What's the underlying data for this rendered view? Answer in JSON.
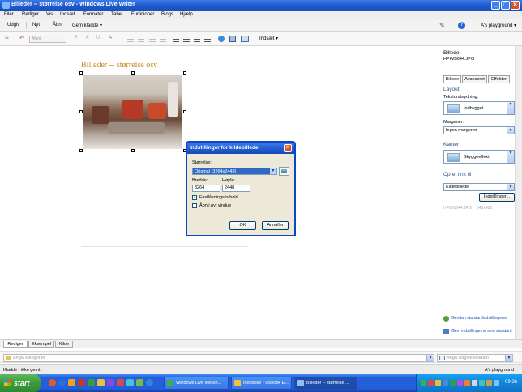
{
  "window": {
    "title": "Billeder  --  størrelse osv - Windows Live Writer",
    "min_glyph": "_",
    "max_glyph": "□",
    "close_glyph": "✕"
  },
  "menu": [
    "Filer",
    "Rediger",
    "Vis",
    "Indsæt",
    "Formater",
    "Tabel",
    "Funktioner",
    "Blogs",
    "Hjælp"
  ],
  "toolbar": {
    "publish": "Udgiv",
    "new": "Nyt",
    "open": "Åbn",
    "save_draft": "Gem kladde ▾",
    "help": "?",
    "account": "A's playground ▾"
  },
  "format_bar": {
    "font_placeholder": "Afsnit",
    "bold": "F",
    "italic": "K",
    "underline": "U",
    "strike": "A",
    "insert": "Indsæt ▾"
  },
  "post": {
    "title": "Billeder  --  størrelse osv"
  },
  "dialog": {
    "title": "Indstillinger for kildebillede",
    "size_label": "Størrelse:",
    "size_value": "Original (3264x2448)",
    "width_label": "Bredde:",
    "height_label": "Højde:",
    "width_value": "3264",
    "height_value": "2448",
    "keep_ratio_label": "Fastlåsningsforhold",
    "keep_ratio_checked": true,
    "new_window_label": "Åbn i nyt vindue",
    "new_window_checked": false,
    "ok": "OK",
    "cancel": "Annuller",
    "close_glyph": "✕"
  },
  "right_pane": {
    "heading": "Billede",
    "filename": "HPIM5644.JPG",
    "tabs": [
      "Billede",
      "Avanceret",
      "Effekter"
    ],
    "layout_section": "Layout",
    "wrap_label": "Tekstombrydning:",
    "wrap_value": "Indbygget",
    "margins_label": "Margener:",
    "margins_value": "Ingen margener",
    "borders_section": "Kanter",
    "border_value": "Skyggeeffekt",
    "link_section": "Opret link til",
    "link_value": "Kildebillede",
    "settings_button": "Indstillinger...",
    "meta_name": "HPIM5644.JPG",
    "meta_size": "640x480",
    "restore_link": "Gendan standardindstillingerne",
    "save_default_link": "Gem indstillingerne som standard"
  },
  "editor_tabs": [
    "Rediger",
    "Eksempel",
    "Kilde"
  ],
  "categories_placeholder": "Angiv kategorier",
  "publish_date_placeholder": "Angiv udgivelsesdato",
  "status": {
    "left": "Kladde - ikke gemt",
    "right": "A's playground"
  },
  "taskbar": {
    "start": "start",
    "tasks": [
      "Windows Live Messe...",
      "Indbakke - Outlook E...",
      "Billeder  --  størrelse ..."
    ],
    "clock": "09:36"
  },
  "colors": {
    "titlebar": "#1f5bd0",
    "post_title": "#c8841a",
    "selection": "#316ac5",
    "start_green": "#3c9a3c"
  }
}
